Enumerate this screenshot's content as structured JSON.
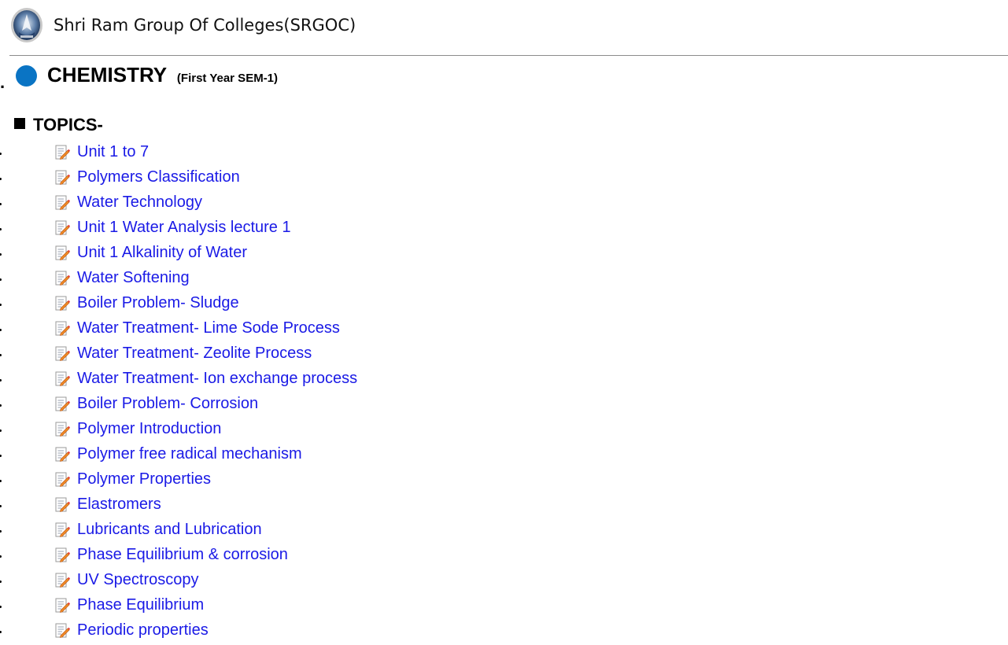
{
  "header": {
    "site_title": "Shri Ram Group Of Colleges(SRGOC)",
    "logo_icon": "college-emblem-icon"
  },
  "subject": {
    "title": "CHEMISTRY",
    "subtitle": "(First Year SEM-1)",
    "circle_color": "#0a74c4"
  },
  "topics": {
    "heading": "TOPICS-",
    "link_color": "#1a1ae6",
    "item_icon": "document-edit-icon",
    "items": [
      {
        "label": "Unit 1 to 7"
      },
      {
        "label": "Polymers Classification"
      },
      {
        "label": "Water Technology"
      },
      {
        "label": "Unit 1 Water Analysis lecture 1"
      },
      {
        "label": "Unit 1 Alkalinity of Water"
      },
      {
        "label": "Water Softening"
      },
      {
        "label": "Boiler Problem- Sludge"
      },
      {
        "label": "Water Treatment- Lime Sode Process"
      },
      {
        "label": "Water Treatment- Zeolite Process"
      },
      {
        "label": "Water Treatment- Ion exchange process"
      },
      {
        "label": "Boiler Problem- Corrosion"
      },
      {
        "label": "Polymer Introduction"
      },
      {
        "label": "Polymer free radical mechanism"
      },
      {
        "label": "Polymer Properties"
      },
      {
        "label": "Elastromers"
      },
      {
        "label": "Lubricants and Lubrication"
      },
      {
        "label": "Phase Equilibrium & corrosion"
      },
      {
        "label": "UV Spectroscopy"
      },
      {
        "label": "Phase Equilibrium"
      },
      {
        "label": "Periodic properties"
      }
    ]
  }
}
